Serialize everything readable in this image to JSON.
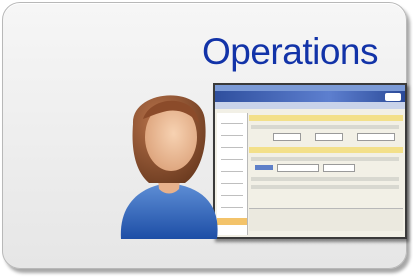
{
  "tile": {
    "title": "Operations"
  }
}
